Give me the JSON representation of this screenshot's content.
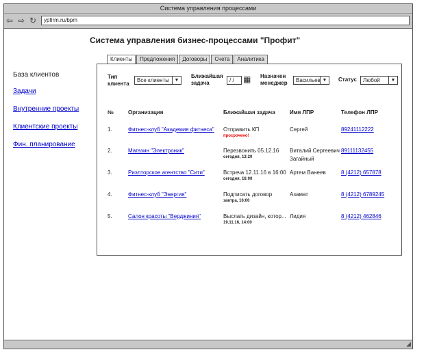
{
  "browser": {
    "title": "Система управления процессами",
    "url": "ypfirm.ru/bpm"
  },
  "page_title": "Система управления бизнес-процессами \"Профит\"",
  "sidebar": {
    "heading": "База клиентов",
    "links": [
      "Задачи",
      "Внутренние проекты",
      "Клиентские проекты",
      "Фин. планирование"
    ]
  },
  "tabs": [
    "Клиенты",
    "Предложения",
    "Договоры",
    "Счета",
    "Аналитика"
  ],
  "filters": {
    "client_type": {
      "label1": "Тип",
      "label2": "клиента",
      "value": "Все клиенты"
    },
    "next_task": {
      "label1": "Ближайшая",
      "label2": "задача",
      "value": "/ /"
    },
    "manager": {
      "label1": "Назначен",
      "label2": "менеджер",
      "value": "Васильев"
    },
    "status": {
      "label": "Статус",
      "value": "Любой"
    }
  },
  "table": {
    "headers": [
      "№",
      "Организация",
      "Ближайшая задача",
      "Имя ЛПР",
      "Телефон ЛПР"
    ],
    "rows": [
      {
        "num": "1.",
        "org": "Фитнес-клуб \"Академия фитнеса\"",
        "task": "Отправить КП",
        "due": "просрочено!",
        "lpr": "Сергей",
        "lpr2": "",
        "phone": "89241112222"
      },
      {
        "num": "2.",
        "org": "Магазин \"Электроник\"",
        "task": "Перезвонить 05.12.16",
        "due": "сегодня, 13:20",
        "lpr": "Виталий Сергеевич",
        "lpr2": "Загайный",
        "phone": "89111132455"
      },
      {
        "num": "3.",
        "org": "Риэлторское агентство \"Сити\"",
        "task": "Встреча 12.11.16 в 16:00",
        "due": "сегодня, 16:00",
        "lpr": "Артем Ванеев",
        "lpr2": "",
        "phone": "8 (4212) 657878"
      },
      {
        "num": "4.",
        "org": "Фитнес-клуб \"Энергия\"",
        "task": "Подписать договор",
        "due": "завтра, 16:00",
        "lpr": "Азамат",
        "lpr2": "",
        "phone": "8 (4212) 6789245"
      },
      {
        "num": "5.",
        "org": "Салон красоты \"Верджиния\"",
        "task": "Выслать дизайн, котор...",
        "due": "19.11.16, 14:00",
        "lpr": "Лидия",
        "lpr2": "",
        "phone": "8 (4212) 462846"
      }
    ]
  }
}
